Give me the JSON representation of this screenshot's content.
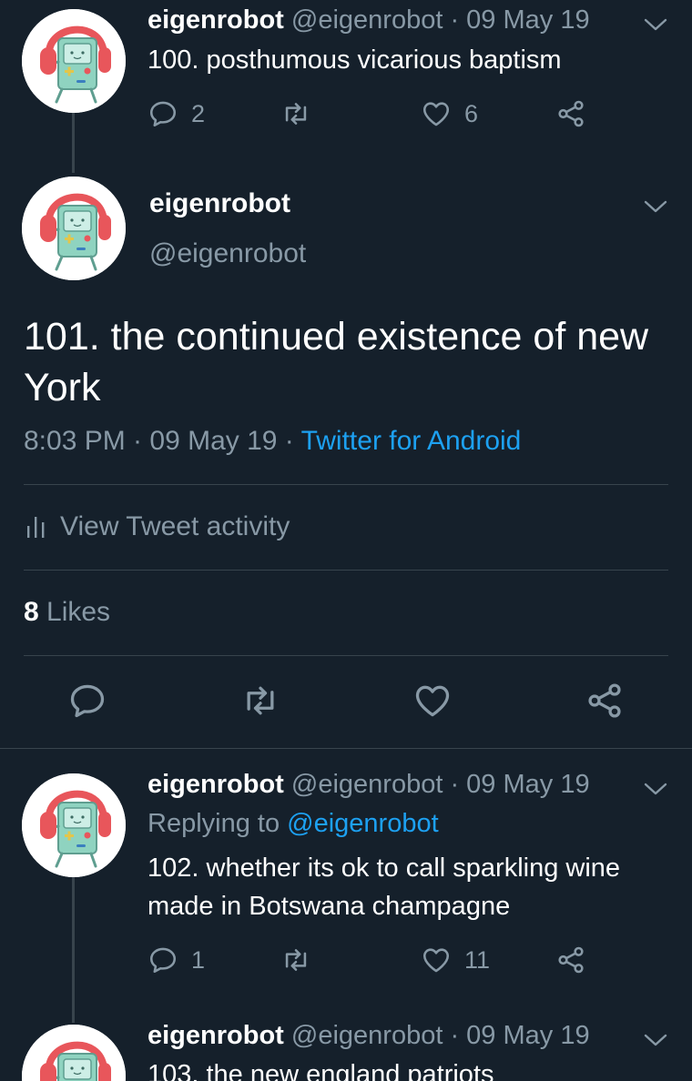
{
  "tweets": [
    {
      "name": "eigenrobot",
      "handle_date": "@eigenrobot · 09 May 19",
      "text": "100. posthumous vicarious baptism",
      "reply_count": "2",
      "retweet_count": "",
      "like_count": "6"
    },
    {
      "name": "eigenrobot",
      "handle_date": "@eigenrobot · 09 May 19",
      "replying_label": "Replying to ",
      "replying_handle": "@eigenrobot",
      "text": "102. whether its ok to call sparkling wine made in Botswana champagne",
      "reply_count": "1",
      "retweet_count": "",
      "like_count": "11"
    },
    {
      "name": "eigenrobot",
      "handle_date": "@eigenrobot · 09 May 19",
      "text": "103. the new england patriots"
    }
  ],
  "main": {
    "name": "eigenrobot",
    "handle": "@eigenrobot",
    "text": "101. the continued existence of new York",
    "time": "8:03 PM · 09 May 19 · ",
    "source": "Twitter for Android",
    "activity_label": "View Tweet activity",
    "likes_count": "8",
    "likes_label": " Likes"
  },
  "icons": [
    "reply-icon",
    "retweet-icon",
    "like-icon",
    "share-icon",
    "chevron-down-icon",
    "analytics-icon"
  ],
  "colors": {
    "background": "#15202b",
    "secondary_text": "#8899a6",
    "link": "#1da1f2",
    "divider": "#38444d"
  }
}
